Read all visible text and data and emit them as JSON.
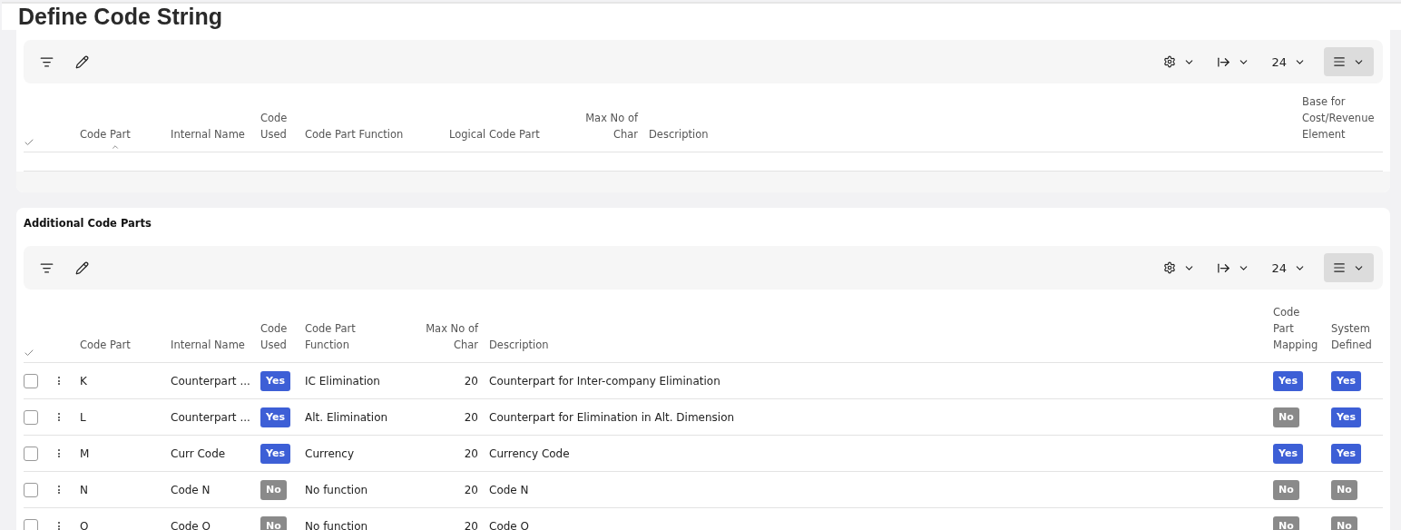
{
  "page": {
    "title": "Define Code String"
  },
  "code_parts": {
    "toolbar": {
      "page_size": "24"
    },
    "columns": [
      {
        "label": "Code Part",
        "sorted": true
      },
      {
        "label": "Internal Name",
        "sorted": false
      },
      {
        "label": "Code Used",
        "sorted": false
      },
      {
        "label": "Code Part Function",
        "sorted": false
      },
      {
        "label": "Logical Code Part",
        "sorted": false
      },
      {
        "label": "Max No of Char",
        "sorted": false
      },
      {
        "label": "Description",
        "sorted": false
      },
      {
        "label": "Base for Cost/Revenue Element",
        "sorted": false
      }
    ]
  },
  "additional_code_parts": {
    "title": "Additional Code Parts",
    "toolbar": {
      "page_size": "24"
    },
    "columns": [
      {
        "label": "Code Part",
        "sorted": false
      },
      {
        "label": "Internal Name",
        "sorted": false
      },
      {
        "label": "Code Used",
        "sorted": false
      },
      {
        "label": "Code Part Function",
        "sorted": false
      },
      {
        "label": "Max No of Char",
        "sorted": false
      },
      {
        "label": "Description",
        "sorted": false
      },
      {
        "label": "Code Part Mapping",
        "sorted": false
      },
      {
        "label": "System Defined",
        "sorted": false
      }
    ],
    "rows": [
      {
        "checked": false,
        "code_part": "K",
        "internal_name": "Counterpart ...",
        "code_used": {
          "text": "Yes",
          "on": true
        },
        "function": "IC Elimination",
        "max_chars": "20",
        "description": "Counterpart for Inter-company Elimination",
        "mapping": {
          "text": "Yes",
          "on": true
        },
        "system": {
          "text": "Yes",
          "on": true
        }
      },
      {
        "checked": false,
        "code_part": "L",
        "internal_name": "Counterpart ...",
        "code_used": {
          "text": "Yes",
          "on": true
        },
        "function": "Alt. Elimination",
        "max_chars": "20",
        "description": "Counterpart for Elimination in Alt. Dimension",
        "mapping": {
          "text": "No",
          "on": false
        },
        "system": {
          "text": "Yes",
          "on": true
        }
      },
      {
        "checked": false,
        "code_part": "M",
        "internal_name": "Curr Code",
        "code_used": {
          "text": "Yes",
          "on": true
        },
        "function": "Currency",
        "max_chars": "20",
        "description": "Currency Code",
        "mapping": {
          "text": "Yes",
          "on": true
        },
        "system": {
          "text": "Yes",
          "on": true
        }
      },
      {
        "checked": false,
        "code_part": "N",
        "internal_name": "Code N",
        "code_used": {
          "text": "No",
          "on": false
        },
        "function": "No function",
        "max_chars": "20",
        "description": "Code N",
        "mapping": {
          "text": "No",
          "on": false
        },
        "system": {
          "text": "No",
          "on": false
        }
      },
      {
        "checked": false,
        "code_part": "O",
        "internal_name": "Code O",
        "code_used": {
          "text": "No",
          "on": false
        },
        "function": "No function",
        "max_chars": "20",
        "description": "Code O",
        "mapping": {
          "text": "No",
          "on": false
        },
        "system": {
          "text": "No",
          "on": false
        }
      }
    ]
  }
}
